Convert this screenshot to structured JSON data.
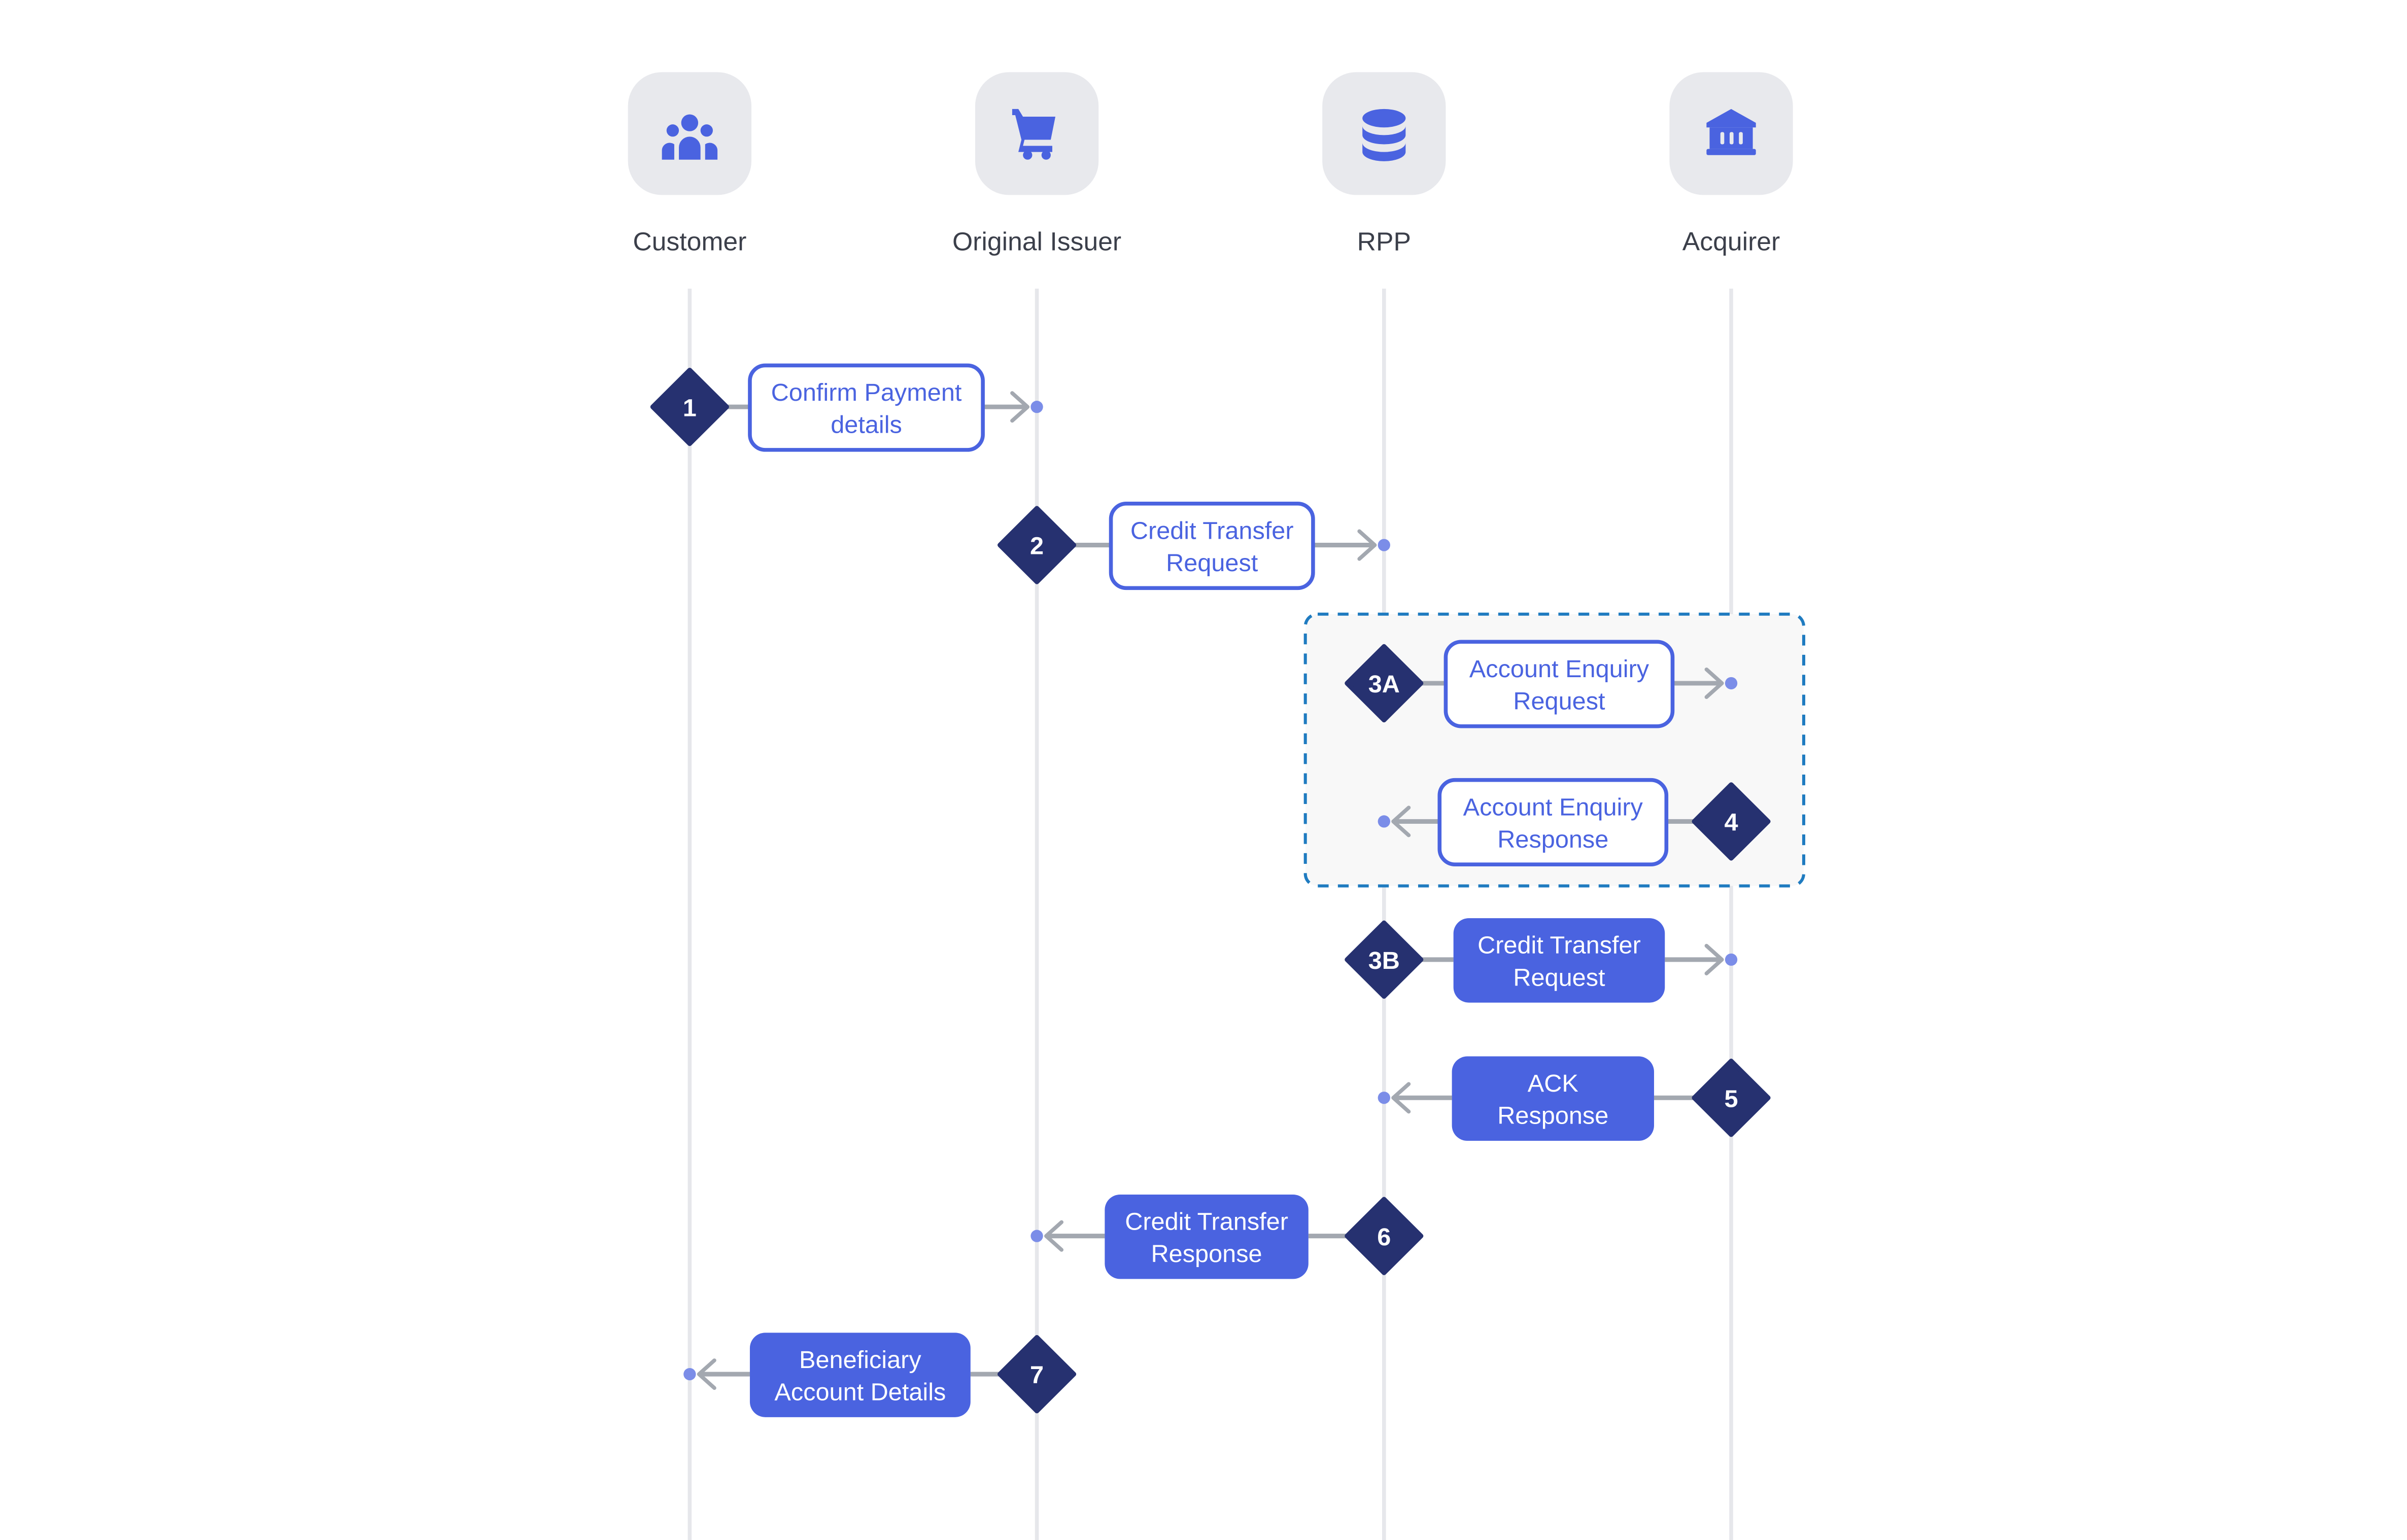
{
  "colors": {
    "accent": "#4a63e0",
    "diamond": "#263170",
    "arrow": "#a3a8b0",
    "dot": "#7b8de8",
    "lifeline": "#e6e7eb",
    "icon_bg": "#e8e9ed",
    "group_border": "#1f7bc0",
    "group_fill": "#f8f8f8"
  },
  "participants": [
    {
      "label": "Customer",
      "icon": "users-icon"
    },
    {
      "label": "Original Issuer",
      "icon": "shopping-cart-icon"
    },
    {
      "label": "RPP",
      "icon": "database-icon"
    },
    {
      "label": "Acquirer",
      "icon": "bank-icon"
    }
  ],
  "group": {
    "style": "dashed",
    "steps": [
      "3A",
      "4"
    ]
  },
  "steps": [
    {
      "number": "1",
      "from": 0,
      "to": 1,
      "lines": [
        "Confirm Payment",
        "details"
      ],
      "style": "outline"
    },
    {
      "number": "2",
      "from": 1,
      "to": 2,
      "lines": [
        "Credit Transfer",
        "Request"
      ],
      "style": "outline"
    },
    {
      "number": "3A",
      "from": 2,
      "to": 3,
      "lines": [
        "Account Enquiry",
        "Request"
      ],
      "style": "outline"
    },
    {
      "number": "4",
      "from": 3,
      "to": 2,
      "lines": [
        "Account Enquiry",
        "Response"
      ],
      "style": "outline"
    },
    {
      "number": "3B",
      "from": 2,
      "to": 3,
      "lines": [
        "Credit Transfer",
        "Request"
      ],
      "style": "filled"
    },
    {
      "number": "5",
      "from": 3,
      "to": 2,
      "lines": [
        "ACK",
        "Response"
      ],
      "style": "filled"
    },
    {
      "number": "6",
      "from": 2,
      "to": 1,
      "lines": [
        "Credit Transfer",
        "Response"
      ],
      "style": "filled"
    },
    {
      "number": "7",
      "from": 1,
      "to": 0,
      "lines": [
        "Beneficiary",
        "Account Details"
      ],
      "style": "filled"
    }
  ]
}
